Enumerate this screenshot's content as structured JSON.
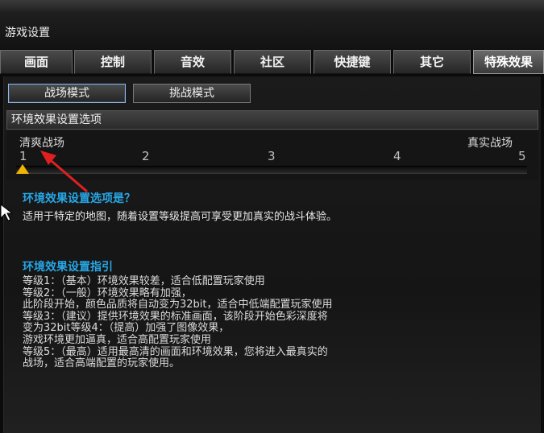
{
  "window": {
    "title": "游戏设置"
  },
  "tabs": [
    {
      "label": "画面"
    },
    {
      "label": "控制"
    },
    {
      "label": "音效"
    },
    {
      "label": "社区"
    },
    {
      "label": "快捷键"
    },
    {
      "label": "其它"
    },
    {
      "label": "特殊效果"
    }
  ],
  "active_tab": "特殊效果",
  "modes": [
    {
      "label": "战场模式"
    },
    {
      "label": "挑战模式"
    }
  ],
  "section": {
    "title": "环境效果设置选项"
  },
  "slider": {
    "left_label": "清爽战场",
    "right_label": "真实战场",
    "ticks": [
      "1",
      "2",
      "3",
      "4",
      "5"
    ],
    "value": 1,
    "min": 1,
    "max": 5
  },
  "info": {
    "question": "环境效果设置选项是？",
    "description": "适用于特定的地图，随着设置等级提高可享受更加真实的战斗体验。"
  },
  "guide": {
    "heading": "环境效果设置指引",
    "lines": [
      "等级1：（基本）环境效果较差，适合低配置玩家使用",
      "等级2：（一般）环境效果略有加强，",
      "此阶段开始，颜色品质将自动变为32bit，适合中低端配置玩家使用",
      "等级3：（建议）提供环境效果的标准画面，该阶段开始色彩深度将",
      "变为32bit等级4：（提高）加强了图像效果，",
      "游戏环境更加逼真，适合高配置玩家使用",
      "等级5：（最高）适用最高清的画面和环境效果，您将进入最真实的",
      "战场，适合高端配置的玩家使用。"
    ]
  },
  "colors": {
    "accent_blue": "#27a7e6",
    "slider_thumb": "#f0b400",
    "annotation_arrow": "#e02020"
  }
}
